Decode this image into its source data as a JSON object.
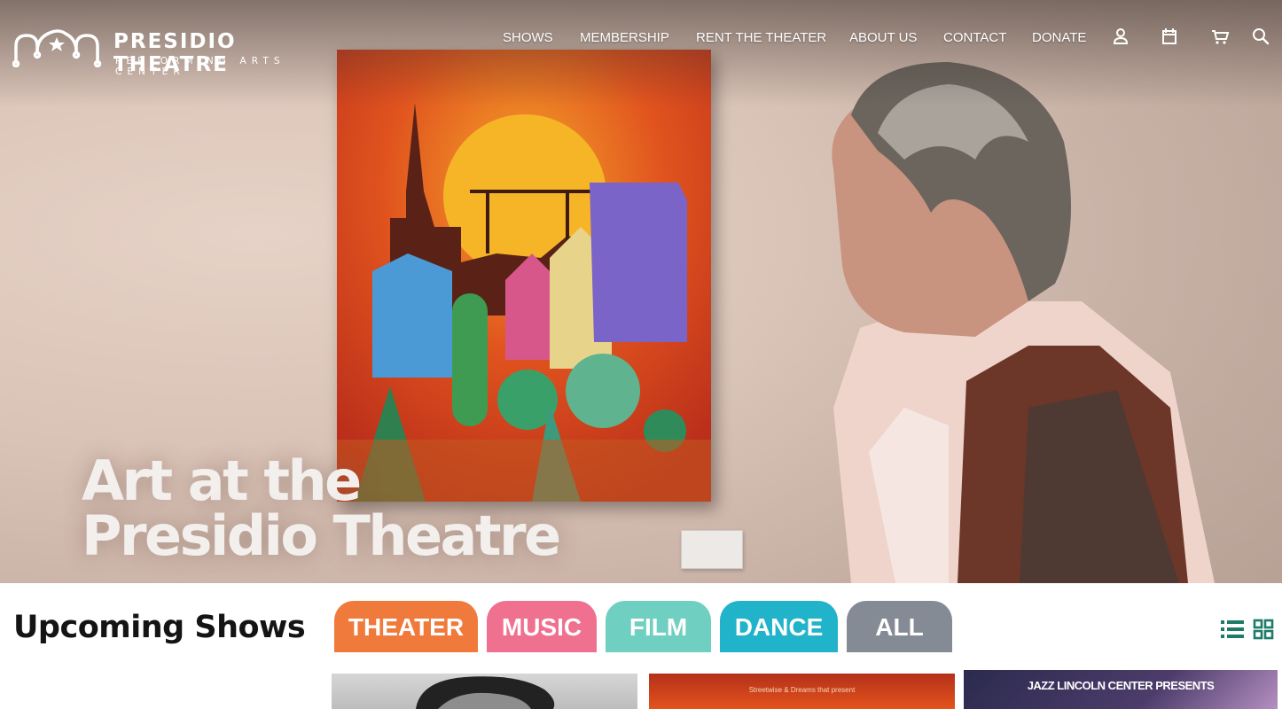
{
  "header": {
    "logo_name": "PRESIDIO THEATRE",
    "logo_subtitle": "PERFORMING ARTS CENTER",
    "nav": [
      "SHOWS",
      "MEMBERSHIP",
      "RENT THE THEATER",
      "ABOUT US",
      "CONTACT",
      "DONATE"
    ],
    "icons": [
      "user-icon",
      "calendar-icon",
      "cart-icon",
      "search-icon"
    ]
  },
  "hero": {
    "title_line1": "Art at the",
    "title_line2": "Presidio Theatre"
  },
  "upcoming": {
    "title": "Upcoming Shows",
    "filters": [
      {
        "label": "THEATER",
        "color": "#ef7a3b"
      },
      {
        "label": "MUSIC",
        "color": "#f0708f"
      },
      {
        "label": "FILM",
        "color": "#6fcfc0"
      },
      {
        "label": "DANCE",
        "color": "#20b3c9"
      },
      {
        "label": "ALL",
        "color": "#858b94"
      }
    ],
    "view_icons": [
      "list-view-icon",
      "grid-view-icon"
    ],
    "accent_color": "#1d7b68"
  },
  "cards": {
    "card2_text": "Streetwise & Dreams that present",
    "card3_text": "JAZZ LINCOLN CENTER PRESENTS"
  }
}
